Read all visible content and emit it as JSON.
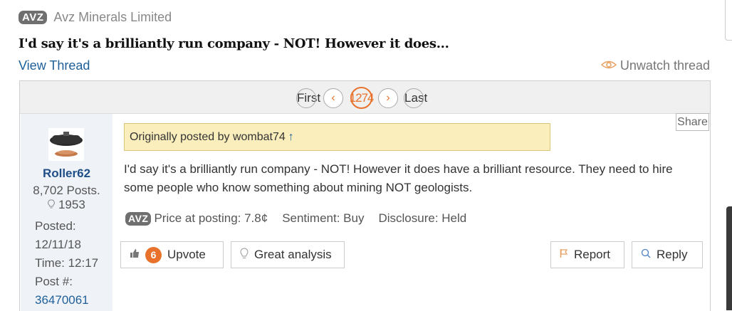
{
  "header": {
    "ticker": "AVZ",
    "company": "Avz Minerals Limited"
  },
  "thread": {
    "title": "I'd say it's a brilliantly run company - NOT! However it does...",
    "view_thread": "View Thread",
    "unwatch": "Unwatch thread"
  },
  "pagination": {
    "first": "First",
    "current": "1274",
    "last": "Last"
  },
  "user": {
    "name": "Roller62",
    "posts": "8,702 Posts.",
    "likes": "1953",
    "posted_label": "Posted:",
    "posted_date": "12/11/18",
    "time": "Time: 12:17",
    "post_num_label": "Post #:",
    "post_num": "36470061"
  },
  "post": {
    "share": "Share",
    "quote": "Originally posted by wombat74",
    "body": "I'd say it's a brilliantly run company - NOT! However it does have a brilliant resource. They need to hire some people who know something about mining NOT geologists.",
    "ticker": "AVZ",
    "price": "Price at posting: 7.8¢",
    "sentiment": "Sentiment: Buy",
    "disclosure": "Disclosure: Held"
  },
  "actions": {
    "upvote_count": "6",
    "upvote": "Upvote",
    "great": "Great analysis",
    "report": "Report",
    "reply": "Reply"
  }
}
